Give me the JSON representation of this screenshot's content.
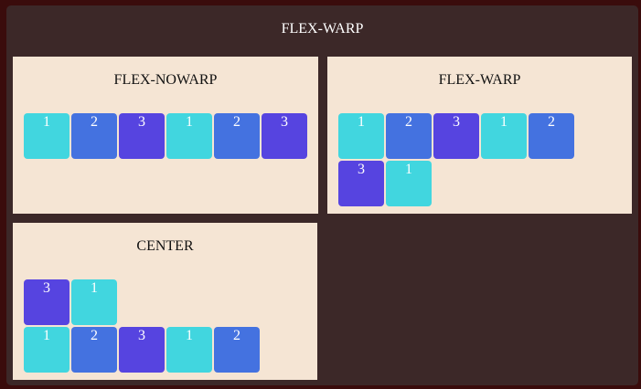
{
  "title": "FLEX-WARP",
  "colors": {
    "one": "#41d6df",
    "two": "#4472e0",
    "three": "#5644e0"
  },
  "panels": [
    {
      "title": "FLEX-NOWARP",
      "rows": [
        [
          "1",
          "2",
          "3",
          "1",
          "2",
          "3"
        ]
      ]
    },
    {
      "title": "FLEX-WARP",
      "rows": [
        [
          "1",
          "2",
          "3",
          "1",
          "2"
        ],
        [
          "3",
          "1"
        ]
      ]
    },
    {
      "title": "CENTER",
      "rows": [
        [
          "3",
          "1"
        ],
        [
          "1",
          "2",
          "3",
          "1",
          "2"
        ]
      ]
    }
  ]
}
